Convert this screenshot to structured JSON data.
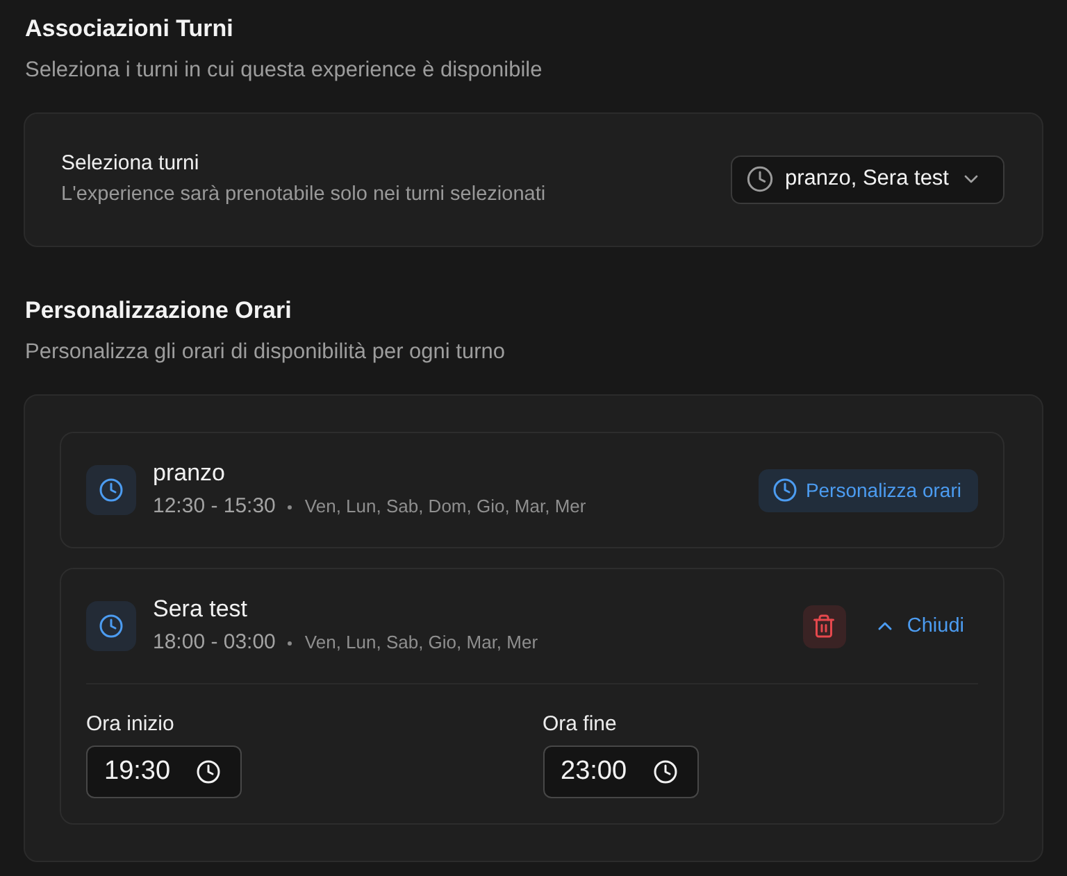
{
  "associations": {
    "title": "Associazioni Turni",
    "subtitle": "Seleziona i turni in cui questa experience è disponibile",
    "select": {
      "label": "Seleziona turni",
      "description": "L'experience sarà prenotabile solo nei turni selezionati",
      "value": "pranzo, Sera test"
    }
  },
  "customization": {
    "title": "Personalizzazione Orari",
    "subtitle": "Personalizza gli orari di disponibilità per ogni turno",
    "shifts": [
      {
        "name": "pranzo",
        "time": "12:30 - 15:30",
        "days": "Ven, Lun, Sab, Dom, Gio, Mar, Mer",
        "expanded": false,
        "action": "Personalizza orari"
      },
      {
        "name": "Sera test",
        "time": "18:00 - 03:00",
        "days": "Ven, Lun, Sab, Gio, Mar, Mer",
        "expanded": true,
        "action": "Chiudi",
        "start": {
          "label": "Ora inizio",
          "value": "19:30"
        },
        "end": {
          "label": "Ora fine",
          "value": "23:00"
        }
      }
    ]
  }
}
